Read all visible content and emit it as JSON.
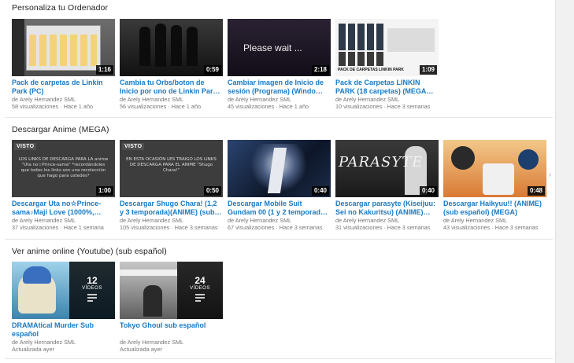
{
  "sections": [
    {
      "title": "Personaliza tu Ordenador",
      "items": [
        {
          "title": "Pack de carpetas de Linkin Park (PC)",
          "channel": "de Arely Hernandez SML",
          "views": "58 visualizaciones",
          "age": "Hace 1 año",
          "duration": "1:16",
          "thumb_style": "windows"
        },
        {
          "title": "Cambia tu Orbs/boton de Inicio por uno de Linkin Par…",
          "channel": "de Arely Hernandez SML",
          "views": "56 visualizaciones",
          "age": "Hace 1 año",
          "duration": "0:59",
          "thumb_style": "band"
        },
        {
          "title": "Cambiar imagen de Inicio de sesión (Programa) (Windo…",
          "channel": "de Arely Hernandez SML",
          "views": "45 visualizaciones",
          "age": "Hace 1 año",
          "duration": "2:18",
          "thumb_style": "please-wait",
          "thumb_text": "Please wait ..."
        },
        {
          "title": "Pack de Carpetas LINKIN PARK (18 carpetas) (MEGA…",
          "channel": "de Arely Hernandez SML",
          "views": "10 visualizaciones",
          "age": "Hace 3 semanas",
          "duration": "1:09",
          "thumb_style": "folders",
          "thumb_text": "PACK DE CARPETAS LINKIN PARK"
        }
      ]
    },
    {
      "title": "Descargar Anime (MEGA)",
      "items": [
        {
          "title": "Descargar Uta no☆Prince-sama♪Maji Love (1000%,…",
          "channel": "de Arely Hernandez SML",
          "views": "37 visualizaciones",
          "age": "Hace 1 semana",
          "duration": "1:00",
          "visto": "VISTO",
          "thumb_style": "text-dark",
          "thumb_text": "LOS LINKS DE DESCARGA PARA LA anime \"Uta no☆Prince-sama\" *recordándoles que todos los links son una recolección que hago para ustedes*"
        },
        {
          "title": "Descargar Shugo Chara! (1,2 y 3 temporada)(ANIME) (sub…",
          "channel": "de Arely Hernandez SML",
          "views": "105 visualizaciones",
          "age": "Hace 3 semanas",
          "duration": "0:50",
          "visto": "VISTO",
          "thumb_style": "text-dark",
          "thumb_text": "EN ESTA OCASIÓN LES TRAIGO LOS LINKS DE DESCARGA PARA EL ANIME \"Shugo Chara!\""
        },
        {
          "title": "Descargar Mobile Suit Gundam 00 (1 y 2 temporad…",
          "channel": "de Arely Hernandez SML",
          "views": "67 visualizaciones",
          "age": "Hace 3 semanas",
          "duration": "0:40",
          "thumb_style": "gundam"
        },
        {
          "title": "Descargar parasyte (Kiseijuu: Sei no Kakuritsu) (ANIME)…",
          "channel": "de Arely Hernandez SML",
          "views": "31 visualizaciones",
          "age": "Hace 3 semanas",
          "duration": "0:40",
          "thumb_style": "parasyte",
          "thumb_text": "PARASYTE"
        },
        {
          "title": "Descargar Haikyuu!! (ANIME) (sub español) (MEGA)",
          "channel": "de Arely Hernandez SML",
          "views": "43 visualizaciones",
          "age": "Hace 3 semanas",
          "duration": "0:48",
          "thumb_style": "haikyuu"
        }
      ]
    },
    {
      "title": "Ver anime online (Youtube) (sub español)",
      "items": [
        {
          "title": "DRAMAtical Murder Sub español",
          "channel": "de Arely Hernandez SML",
          "updated": "Actualizada ayer",
          "count": "12",
          "count_label": "VÍDEOS",
          "thumb_style": "dmmd"
        },
        {
          "title": "Tokyo Ghoul sub español",
          "channel": "de Arely Hernandez SML",
          "updated": "Actualizada ayer",
          "count": "24",
          "count_label": "VÍDEOS",
          "thumb_style": "ghoul"
        }
      ]
    }
  ],
  "next_arrow": "›"
}
